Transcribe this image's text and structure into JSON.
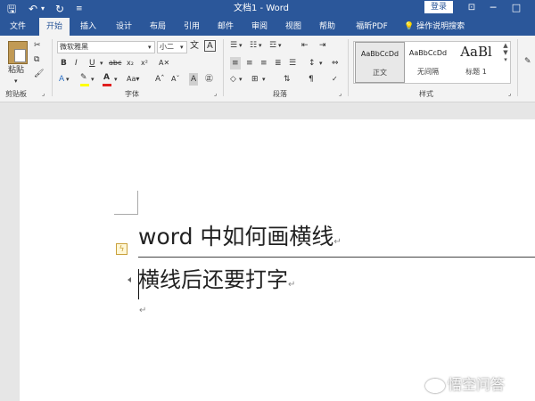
{
  "window": {
    "title": "文档1 - Word",
    "login": "登录",
    "icons": {
      "save": "save-icon",
      "undo": "undo-icon",
      "redo": "redo-icon",
      "customize": "customize-qat-icon"
    }
  },
  "tabs": [
    "文件",
    "开始",
    "插入",
    "设计",
    "布局",
    "引用",
    "邮件",
    "审阅",
    "视图",
    "帮助",
    "福昕PDF"
  ],
  "active_tab": "开始",
  "tell_me": "操作说明搜索",
  "ribbon": {
    "clipboard": {
      "label": "剪贴板",
      "paste": "粘贴"
    },
    "font": {
      "label": "字体",
      "name": "微软雅黑",
      "size": "小二",
      "wen_button": "文",
      "char_border": "A",
      "font_color": "#e02020",
      "highlight_color": "#ffff00"
    },
    "paragraph": {
      "label": "段落"
    },
    "styles": {
      "label": "样式",
      "items": [
        {
          "sample": "AaBbCcDd",
          "name": "正文"
        },
        {
          "sample": "AaBbCcDd",
          "name": "无间隔"
        },
        {
          "sample": "AaBl",
          "name": "标题 1"
        }
      ]
    }
  },
  "document": {
    "heading": "word 中如何画横线",
    "body": "横线后还要打字",
    "pilcrow": "↵"
  },
  "watermark": "悟空问答"
}
